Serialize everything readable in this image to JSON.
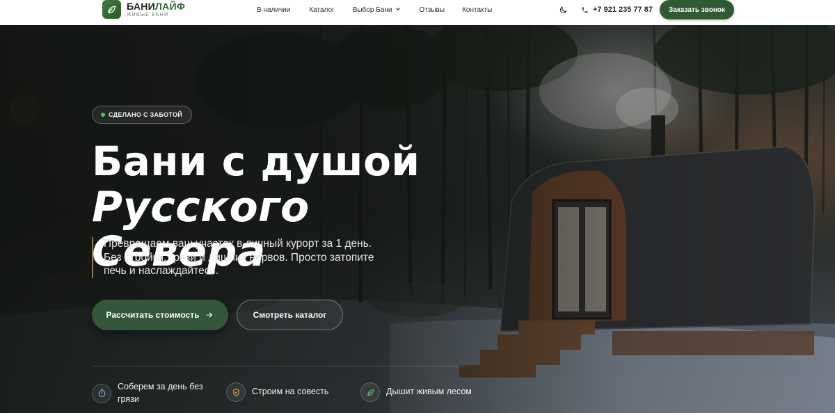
{
  "header": {
    "logo": {
      "title_main": "БАНИ",
      "title_accent": "ЛАЙФ",
      "subtitle": "ЖИВЫЕ БАНИ"
    },
    "nav": [
      {
        "label": "В наличии"
      },
      {
        "label": "Каталог"
      },
      {
        "label": "Выбор Бани",
        "has_dropdown": true
      },
      {
        "label": "Отзывы"
      },
      {
        "label": "Контакты"
      }
    ],
    "phone": "+7 921 235 77 87",
    "callback_label": "Заказать звонок",
    "icons": {
      "logo": "leaf-icon",
      "theme": "moon-icon",
      "phone": "phone-icon",
      "dropdown": "chevron-down-icon"
    }
  },
  "hero": {
    "badge": "СДЕЛАНО С ЗАБОТОЙ",
    "title_line1": "Бани с душой",
    "title_line2": "Русского Севера",
    "lead": "Превращаем ваш участок в личный курорт за 1 день. Без стройки, грязи и лишних нервов. Просто затопите печь и наслаждайтесь.",
    "primary_cta": "Рассчитать стоимость",
    "secondary_cta": "Смотреть каталог",
    "features": [
      {
        "icon": "stopwatch-icon",
        "label": "Соберем за день без грязи"
      },
      {
        "icon": "shield-check-icon",
        "label": "Строим на совесть"
      },
      {
        "icon": "leaf-icon",
        "label": "Дышит живым лесом"
      }
    ]
  },
  "colors": {
    "brand_green": "#2f5a32",
    "button_green": "#34563a",
    "badge_dot": "#4ec36a",
    "lead_accent": "#a8733e",
    "feature_icon_gold": "#d9b04a",
    "feature_icon_blue": "#7fb0e0"
  }
}
